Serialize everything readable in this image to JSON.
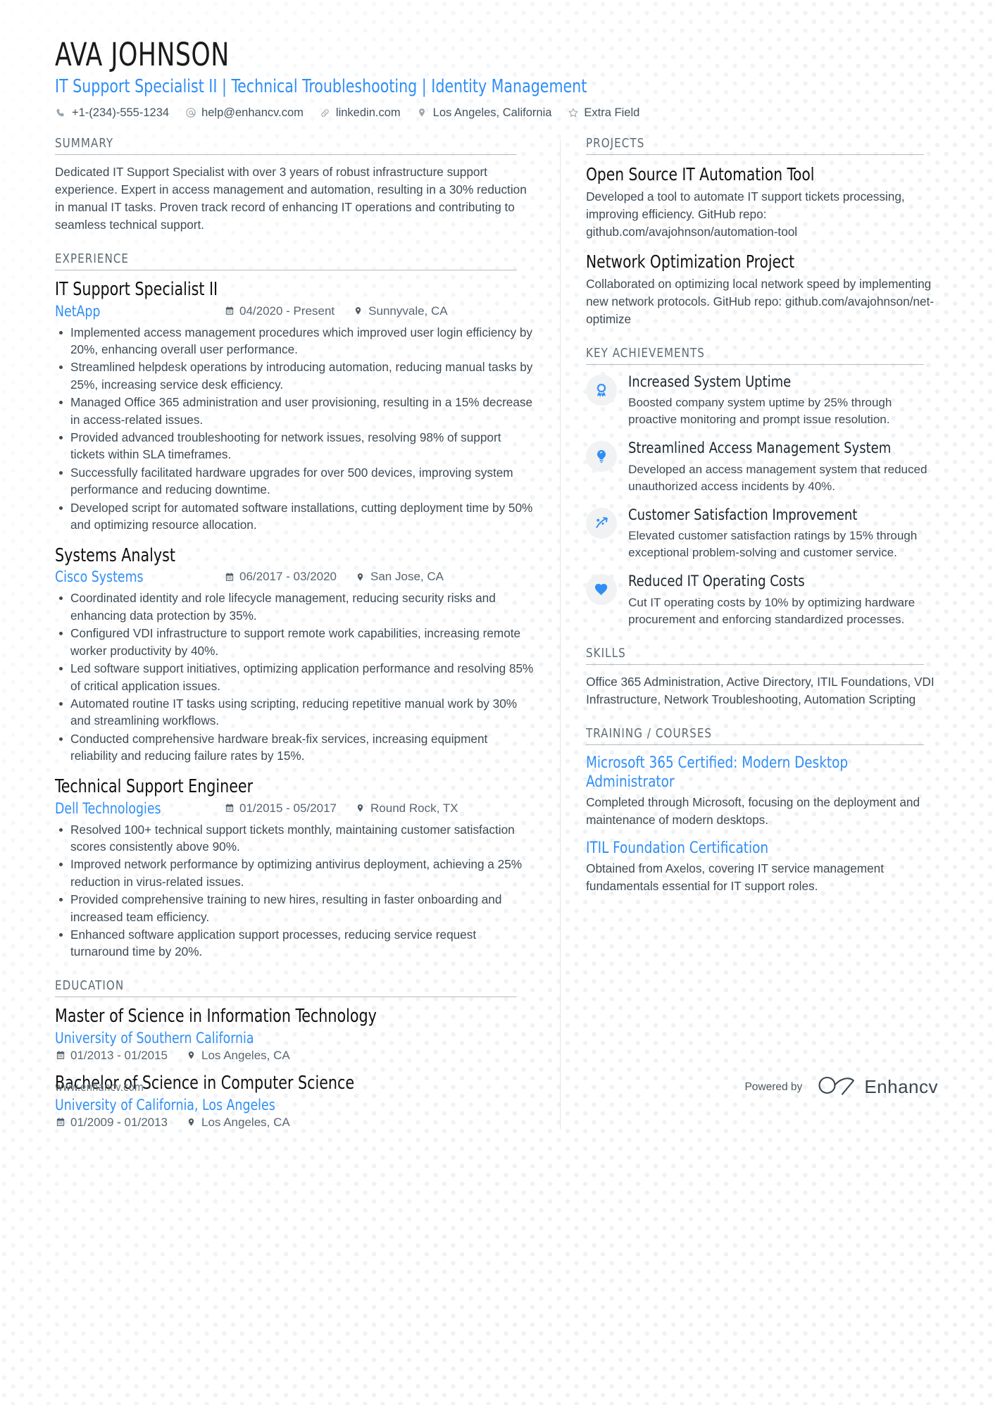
{
  "header": {
    "name": "AVA JOHNSON",
    "headline": "IT Support Specialist II | Technical Troubleshooting | Identity Management",
    "contacts": [
      {
        "icon": "phone-icon",
        "text": "+1-(234)-555-1234"
      },
      {
        "icon": "email-icon",
        "text": "help@enhancv.com"
      },
      {
        "icon": "link-icon",
        "text": "linkedin.com"
      },
      {
        "icon": "location-pin-icon",
        "text": "Los Angeles, California"
      },
      {
        "icon": "star-icon",
        "text": "Extra Field"
      }
    ]
  },
  "sections": {
    "summary": {
      "title": "SUMMARY",
      "text": "Dedicated IT Support Specialist with over 3 years of robust infrastructure support experience. Expert in access management and automation, resulting in a 30% reduction in manual IT tasks. Proven track record of enhancing IT operations and contributing to seamless technical support."
    },
    "experience": {
      "title": "EXPERIENCE",
      "jobs": [
        {
          "title": "IT Support Specialist II",
          "company": "NetApp",
          "dates": "04/2020 - Present",
          "location": "Sunnyvale, CA",
          "bullets": [
            "Implemented access management procedures which improved user login efficiency by 20%, enhancing overall user performance.",
            "Streamlined helpdesk operations by introducing automation, reducing manual tasks by 25%, increasing service desk efficiency.",
            "Managed Office 365 administration and user provisioning, resulting in a 15% decrease in access-related issues.",
            "Provided advanced troubleshooting for network issues, resolving 98% of support tickets within SLA timeframes.",
            "Successfully facilitated hardware upgrades for over 500 devices, improving system performance and reducing downtime.",
            "Developed script for automated software installations, cutting deployment time by 50% and optimizing resource allocation."
          ]
        },
        {
          "title": "Systems Analyst",
          "company": "Cisco Systems",
          "dates": "06/2017 - 03/2020",
          "location": "San Jose, CA",
          "bullets": [
            "Coordinated identity and role lifecycle management, reducing security risks and enhancing data protection by 35%.",
            "Configured VDI infrastructure to support remote work capabilities, increasing remote worker productivity by 40%.",
            "Led software support initiatives, optimizing application performance and resolving 85% of critical application issues.",
            "Automated routine IT tasks using scripting, reducing repetitive manual work by 30% and streamlining workflows.",
            "Conducted comprehensive hardware break-fix services, increasing equipment reliability and reducing failure rates by 15%."
          ]
        },
        {
          "title": "Technical Support Engineer",
          "company": "Dell Technologies",
          "dates": "01/2015 - 05/2017",
          "location": "Round Rock, TX",
          "bullets": [
            "Resolved 100+ technical support tickets monthly, maintaining customer satisfaction scores consistently above 90%.",
            "Improved network performance by optimizing antivirus deployment, achieving a 25% reduction in virus-related issues.",
            "Provided comprehensive training to new hires, resulting in faster onboarding and increased team efficiency.",
            "Enhanced software application support processes, reducing service request turnaround time by 20%."
          ]
        }
      ]
    },
    "education": {
      "title": "EDUCATION",
      "entries": [
        {
          "degree": "Master of Science in Information Technology",
          "school": "University of Southern California",
          "dates": "01/2013 - 01/2015",
          "location": "Los Angeles, CA"
        },
        {
          "degree": "Bachelor of Science in Computer Science",
          "school": "University of California, Los Angeles",
          "dates": "01/2009 - 01/2013",
          "location": "Los Angeles, CA"
        }
      ]
    },
    "projects": {
      "title": "PROJECTS",
      "entries": [
        {
          "name": "Open Source IT Automation Tool",
          "desc": "Developed a tool to automate IT support tickets processing, improving efficiency. GitHub repo: github.com/avajohnson/automation-tool"
        },
        {
          "name": "Network Optimization Project",
          "desc": "Collaborated on optimizing local network speed by implementing new network protocols. GitHub repo: github.com/avajohnson/net-optimize"
        }
      ]
    },
    "achievements": {
      "title": "KEY ACHIEVEMENTS",
      "entries": [
        {
          "icon": "award-ribbon-icon",
          "title": "Increased System Uptime",
          "desc": "Boosted company system uptime by 25% through proactive monitoring and prompt issue resolution."
        },
        {
          "icon": "lightbulb-icon",
          "title": "Streamlined Access Management System",
          "desc": "Developed an access management system that reduced unauthorized access incidents by 40%."
        },
        {
          "icon": "trend-arrow-icon",
          "title": "Customer Satisfaction Improvement",
          "desc": "Elevated customer satisfaction ratings by 15% through exceptional problem-solving and customer service."
        },
        {
          "icon": "heart-icon",
          "title": "Reduced IT Operating Costs",
          "desc": "Cut IT operating costs by 10% by optimizing hardware procurement and enforcing standardized processes."
        }
      ]
    },
    "skills": {
      "title": "SKILLS",
      "text": "Office 365 Administration, Active Directory, ITIL Foundations, VDI Infrastructure, Network Troubleshooting, Automation Scripting"
    },
    "training": {
      "title": "TRAINING / COURSES",
      "entries": [
        {
          "name": "Microsoft 365 Certified: Modern Desktop Administrator",
          "desc": "Completed through Microsoft, focusing on the deployment and maintenance of modern desktops."
        },
        {
          "name": "ITIL Foundation Certification",
          "desc": "Obtained from Axelos, covering IT service management fundamentals essential for IT support roles."
        }
      ]
    }
  },
  "footer": {
    "url": "www.enhancv.com",
    "powered_by": "Powered by",
    "brand": "Enhancv"
  },
  "colors": {
    "accent": "#2f8ef4",
    "heading": "#5c6a73",
    "text": "#3f4b54",
    "dot": "#e9ecee"
  }
}
